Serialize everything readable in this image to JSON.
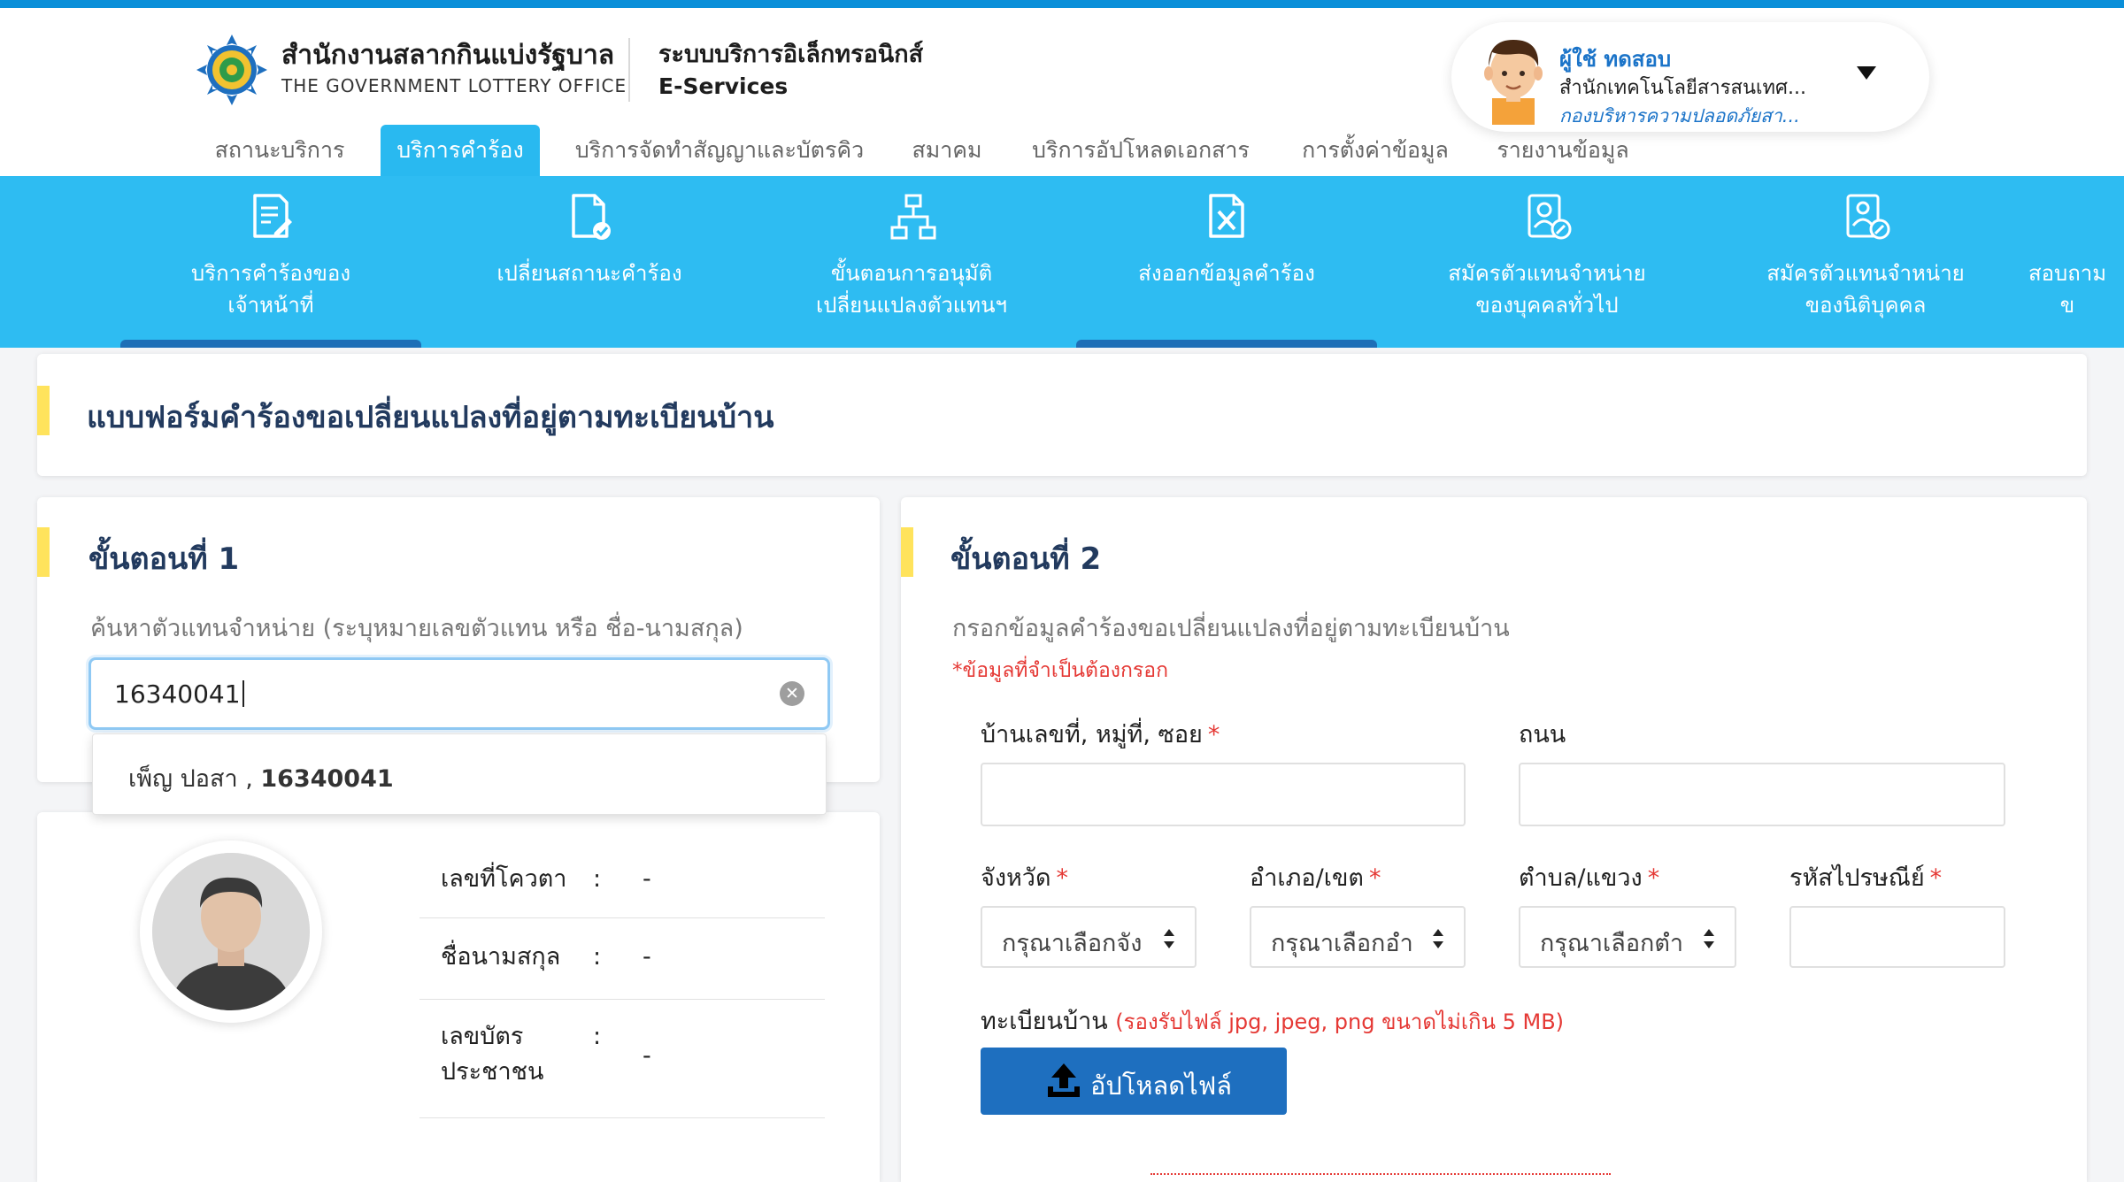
{
  "header": {
    "org_name_th": "สำนักงานสลากกินแบ่งรัฐบาล",
    "org_name_en": "THE GOVERNMENT LOTTERY OFFICE",
    "system_name_th": "ระบบบริการอิเล็กทรอนิกส์",
    "system_name_en": "E-Services"
  },
  "user": {
    "name": "ผู้ใช้ ทดสอบ",
    "department": "สำนักเทคโนโลยีสารสนเทศ...",
    "division": "กองบริหารความปลอดภัยสา..."
  },
  "tabs": [
    {
      "label": "สถานะบริการ",
      "active": false
    },
    {
      "label": "บริการคำร้อง",
      "active": true
    },
    {
      "label": "บริการจัดทำสัญญาและบัตรคิว",
      "active": false
    },
    {
      "label": "สมาคม",
      "active": false
    },
    {
      "label": "บริการอัปโหลดเอกสาร",
      "active": false
    },
    {
      "label": "การตั้งค่าข้อมูล",
      "active": false
    },
    {
      "label": "รายงานข้อมูล",
      "active": false
    }
  ],
  "icon_menu": [
    {
      "label": "บริการคำร้องของ\nเจ้าหน้าที่",
      "icon": "document-edit-icon",
      "selected": true
    },
    {
      "label": "เปลี่ยนสถานะคำร้อง",
      "icon": "document-check-icon",
      "selected": false
    },
    {
      "label": "ขั้นตอนการอนุมัติ\nเปลี่ยนแปลงตัวแทนฯ",
      "icon": "hierarchy-icon",
      "selected": false
    },
    {
      "label": "ส่งออกข้อมูลคำร้อง",
      "icon": "excel-export-icon",
      "selected": true
    },
    {
      "label": "สมัครตัวแทนจำหน่าย\nของบุคคลทั่วไป",
      "icon": "person-register-icon",
      "selected": false
    },
    {
      "label": "สมัครตัวแทนจำหน่าย\nของนิติบุคคล",
      "icon": "corporate-register-icon",
      "selected": false
    },
    {
      "label": "สอบถาม\nข",
      "icon": "",
      "selected": false
    }
  ],
  "form_title": "แบบฟอร์มคำร้องขอเปลี่ยนแปลงที่อยู่ตามทะเบียนบ้าน",
  "step1": {
    "title": "ขั้นตอนที่ 1",
    "search_hint": "ค้นหาตัวแทนจำหน่าย (ระบุหมายเลขตัวแทน หรือ ชื่อ-นามสกุล)",
    "search_value": "16340041",
    "suggestion_name": "เพ็ญ ปอสา , ",
    "suggestion_id": "16340041",
    "info": [
      {
        "label": "เลขที่โควตา",
        "value": "-"
      },
      {
        "label": "ชื่อนามสกุล",
        "value": "-"
      },
      {
        "label": "เลขบัตรประชาชน",
        "value": "-"
      }
    ]
  },
  "step2": {
    "title": "ขั้นตอนที่ 2",
    "hint": "กรอกข้อมูลคำร้องขอเปลี่ยนแปลงที่อยู่ตามทะเบียนบ้าน",
    "required_note": "*ข้อมูลที่จำเป็นต้องกรอก",
    "house_no_label": "บ้านเลขที่, หมู่ที่, ซอย",
    "road_label": "ถนน",
    "province_label": "จังหวัด",
    "province_placeholder": "กรุณาเลือกจัง",
    "district_label": "อำเภอ/เขต",
    "district_placeholder": "กรุณาเลือกอำ",
    "subdistrict_label": "ตำบล/แขวง",
    "subdistrict_placeholder": "กรุณาเลือกตำ",
    "postcode_label": "รหัสไปรษณีย์",
    "house_reg_label": "ทะเบียนบ้าน",
    "upload_note": "(รองรับไฟล์ jpg, jpeg, png ขนาดไม่เกิน 5 MB)",
    "upload_button": "อัปโหลดไฟล์"
  },
  "colors": {
    "accent": "#2ebcf2",
    "primary_button": "#1e6fbf",
    "title_bar": "#ffe35c",
    "required": "#e53935"
  }
}
